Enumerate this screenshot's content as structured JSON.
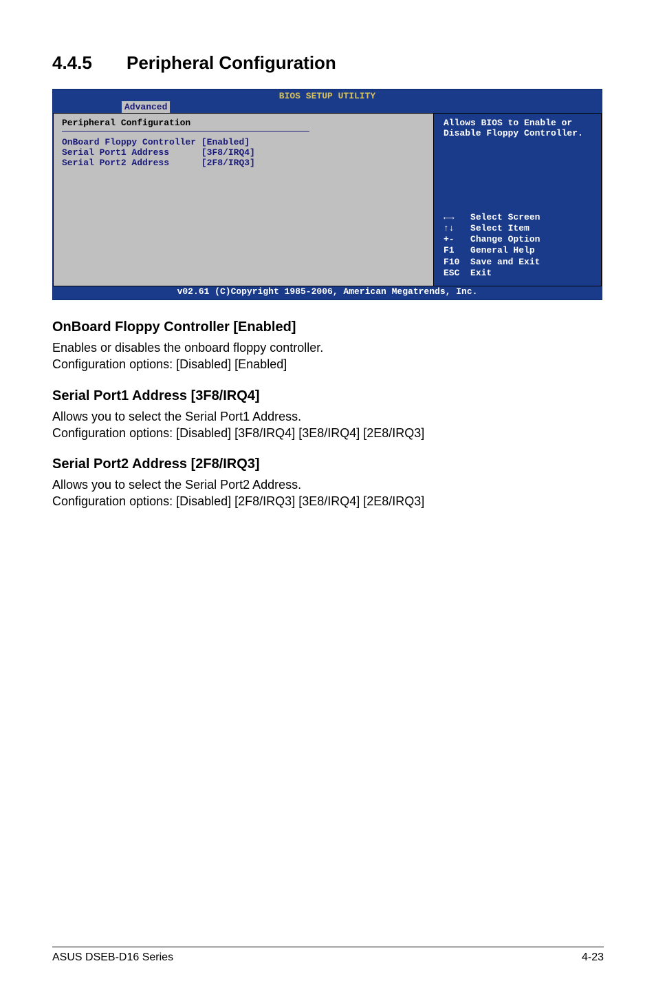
{
  "section": {
    "number": "4.4.5",
    "title": "Peripheral Configuration"
  },
  "bios": {
    "header_title": "BIOS SETUP UTILITY",
    "tab": "Advanced",
    "panel_heading": "Peripheral Configuration",
    "items": [
      {
        "label": "OnBoard Floppy Controller",
        "value": "[Enabled]"
      },
      {
        "label": "Serial Port1 Address",
        "value": "[3F8/IRQ4]"
      },
      {
        "label": "Serial Port2 Address",
        "value": "[2F8/IRQ3]"
      }
    ],
    "help_text": "Allows BIOS to Enable or Disable Floppy Controller.",
    "keys": [
      {
        "k": "←→",
        "d": "Select Screen"
      },
      {
        "k": "↑↓",
        "d": "Select Item"
      },
      {
        "k": "+-",
        "d": "Change Option"
      },
      {
        "k": "F1",
        "d": "General Help"
      },
      {
        "k": "F10",
        "d": "Save and Exit"
      },
      {
        "k": "ESC",
        "d": "Exit"
      }
    ],
    "footer": "v02.61 (C)Copyright 1985-2006, American Megatrends, Inc."
  },
  "blocks": [
    {
      "heading": "OnBoard Floppy Controller [Enabled]",
      "line1": "Enables or disables the onboard floppy controller.",
      "line2": "Configuration options: [Disabled] [Enabled]"
    },
    {
      "heading": "Serial Port1 Address [3F8/IRQ4]",
      "line1": "Allows you to select the Serial Port1 Address.",
      "line2": "Configuration options: [Disabled] [3F8/IRQ4] [3E8/IRQ4] [2E8/IRQ3]"
    },
    {
      "heading": "Serial Port2 Address [2F8/IRQ3]",
      "line1": "Allows you to select the Serial Port2 Address.",
      "line2": "Configuration options: [Disabled] [2F8/IRQ3] [3E8/IRQ4] [2E8/IRQ3]"
    }
  ],
  "page_footer": {
    "left": "ASUS DSEB-D16 Series",
    "right": "4-23"
  }
}
